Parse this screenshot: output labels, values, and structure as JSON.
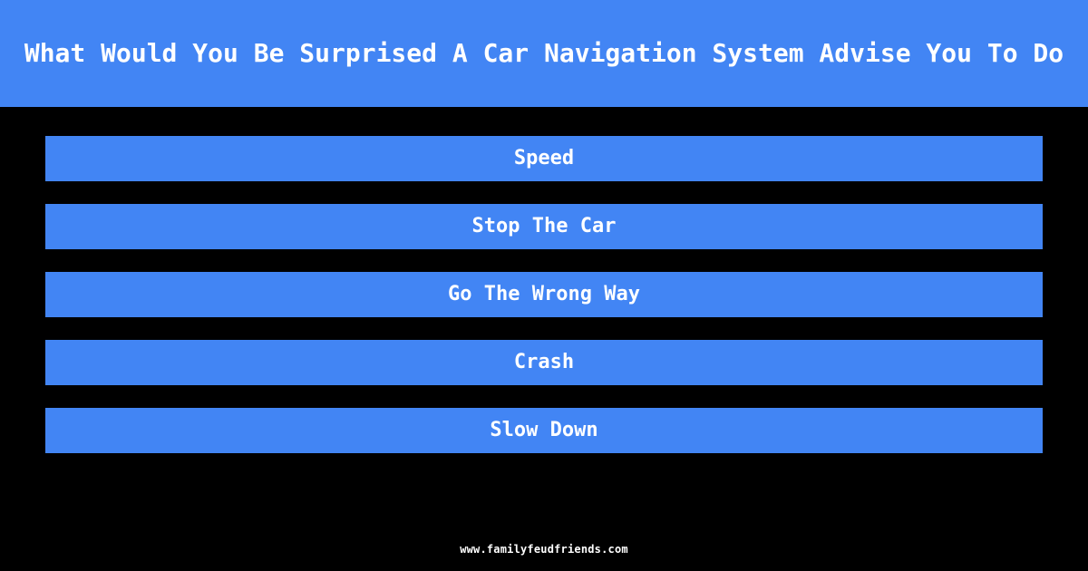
{
  "theme": {
    "background_color": "#000000",
    "accent_color": "#4285f4",
    "text_color": "#ffffff"
  },
  "header": {
    "question": "What Would You Be Surprised A Car Navigation System Advise You To Do"
  },
  "answers": {
    "items": [
      {
        "label": "Speed"
      },
      {
        "label": "Stop The Car"
      },
      {
        "label": "Go The Wrong Way"
      },
      {
        "label": "Crash"
      },
      {
        "label": "Slow Down"
      }
    ]
  },
  "footer": {
    "site": "www.familyfeudfriends.com"
  }
}
